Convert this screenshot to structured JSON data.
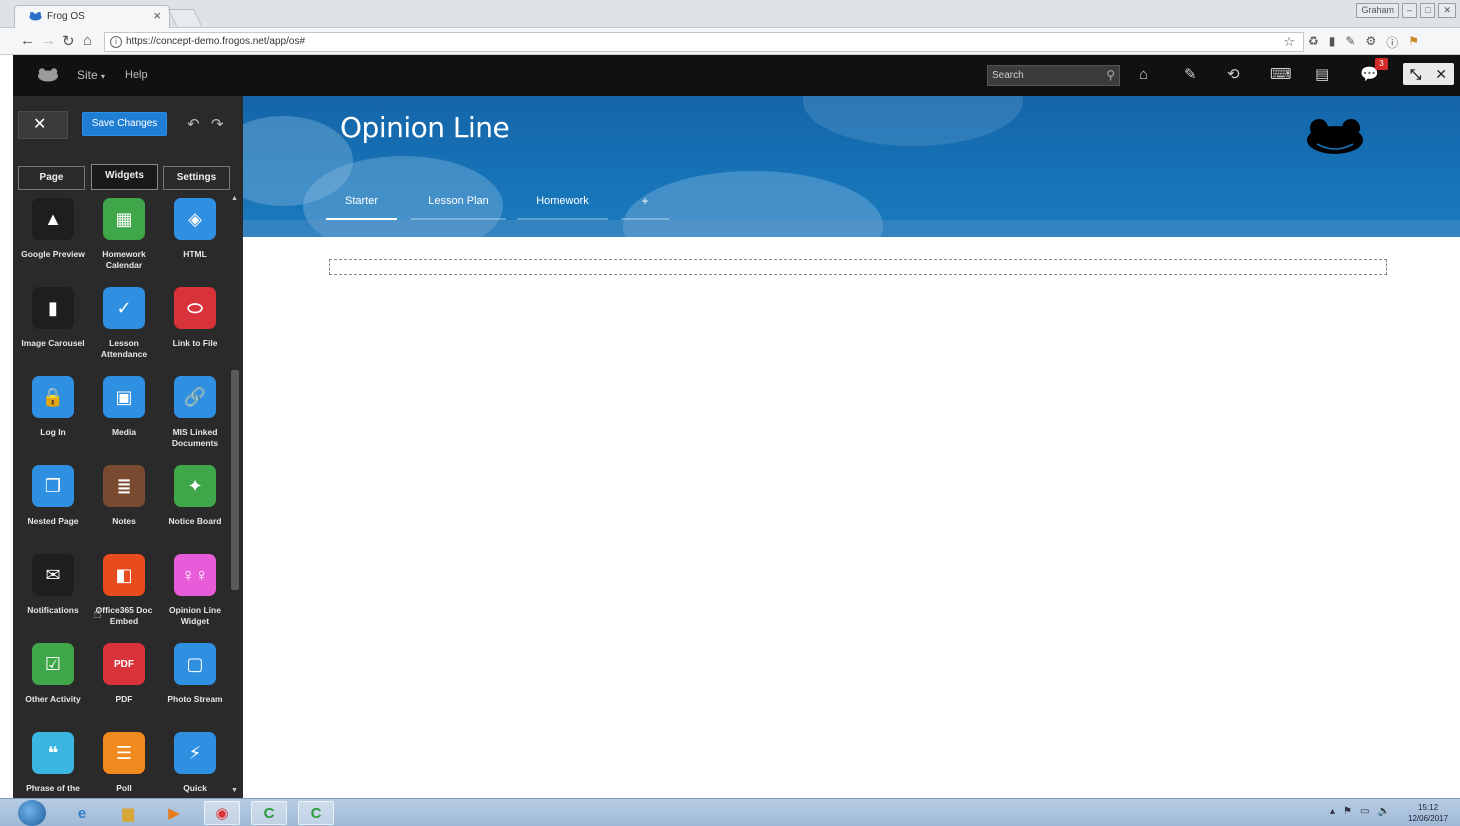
{
  "browser": {
    "tab_title": "Frog OS",
    "tab_close": "×",
    "url": "https://concept-demo.frogos.net/app/os#",
    "window_controls": [
      "Graham",
      "–",
      "□",
      "✕"
    ]
  },
  "topbar": {
    "site_label": "Site",
    "help_label": "Help",
    "search_placeholder": "Search",
    "notification_count": "3"
  },
  "editor": {
    "save_label": "Save Changes",
    "tabs": [
      "Page",
      "Widgets",
      "Settings"
    ],
    "active_tab": "Widgets",
    "widgets": [
      {
        "label": "Google Preview",
        "icon": "google-drive-icon",
        "color": "#1e1e1e"
      },
      {
        "label": "Homework Calendar",
        "icon": "homework-calendar-icon",
        "color": "#3fa64a"
      },
      {
        "label": "HTML",
        "icon": "html-icon",
        "color": "#2f8fe0"
      },
      {
        "label": "Image Carousel",
        "icon": "image-carousel-icon",
        "color": "#1e1e1e"
      },
      {
        "label": "Lesson Attendance",
        "icon": "lesson-attendance-icon",
        "color": "#2f8fe0"
      },
      {
        "label": "Link to File",
        "icon": "link-to-file-icon",
        "color": "#d8323a"
      },
      {
        "label": "Log In",
        "icon": "log-in-icon",
        "color": "#2f8fe0"
      },
      {
        "label": "Media",
        "icon": "media-icon",
        "color": "#2f8fe0"
      },
      {
        "label": "MIS Linked Documents",
        "icon": "mis-linked-documents-icon",
        "color": "#2f8fe0"
      },
      {
        "label": "Nested Page",
        "icon": "nested-page-icon",
        "color": "#2f8fe0"
      },
      {
        "label": "Notes",
        "icon": "notes-icon",
        "color": "#7a4a30"
      },
      {
        "label": "Notice Board",
        "icon": "notice-board-icon",
        "color": "#3fa64a"
      },
      {
        "label": "Notifications",
        "icon": "notifications-icon",
        "color": "#1e1e1e"
      },
      {
        "label": "Office365 Doc Embed",
        "icon": "office365-icon",
        "color": "#e84b1d"
      },
      {
        "label": "Opinion Line Widget",
        "icon": "opinion-line-icon",
        "color": "#e85cd9"
      },
      {
        "label": "Other Activity",
        "icon": "other-activity-icon",
        "color": "#3fa64a"
      },
      {
        "label": "PDF",
        "icon": "pdf-icon",
        "color": "#d8323a"
      },
      {
        "label": "Photo Stream",
        "icon": "photo-stream-icon",
        "color": "#2f8fe0"
      },
      {
        "label": "Phrase of the",
        "icon": "phrase-icon",
        "color": "#3bb6e0"
      },
      {
        "label": "Poll",
        "icon": "poll-icon",
        "color": "#f08a1e"
      },
      {
        "label": "Quick",
        "icon": "quick-icon",
        "color": "#2f8fe0"
      }
    ]
  },
  "page": {
    "title": "Opinion Line",
    "tabs": [
      "Starter",
      "Lesson Plan",
      "Homework",
      "+"
    ],
    "active_tab": "Starter"
  },
  "taskbar": {
    "time": "15:12",
    "date": "12/06/2017"
  }
}
